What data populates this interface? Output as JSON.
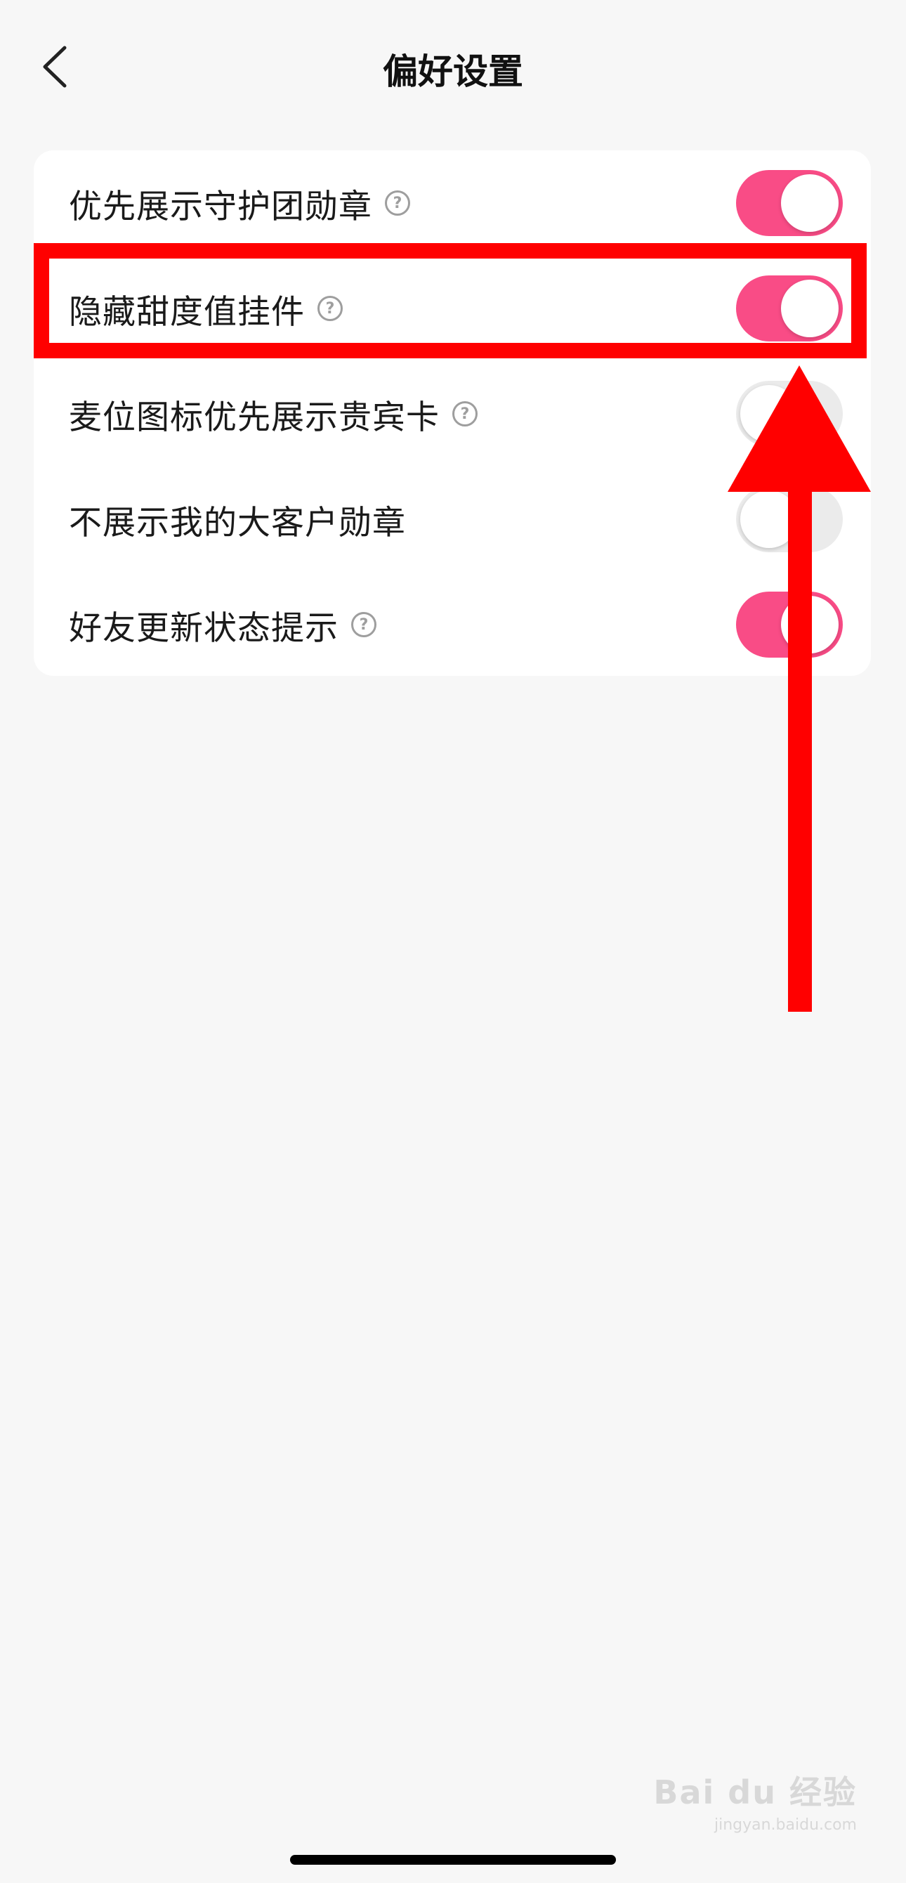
{
  "header": {
    "title": "偏好设置",
    "back_icon": "chevron-left-icon"
  },
  "settings": [
    {
      "label": "优先展示守护团勋章",
      "has_help": true,
      "enabled": true
    },
    {
      "label": "隐藏甜度值挂件",
      "has_help": true,
      "enabled": true
    },
    {
      "label": "麦位图标优先展示贵宾卡",
      "has_help": true,
      "enabled": false
    },
    {
      "label": "不展示我的大客户勋章",
      "has_help": false,
      "enabled": false
    },
    {
      "label": "好友更新状态提示",
      "has_help": true,
      "enabled": true
    }
  ],
  "help_glyph": "?",
  "colors": {
    "background": "#f7f7f7",
    "card": "#ffffff",
    "toggle_on": "#f94c86",
    "toggle_off": "#ebebeb",
    "annotation": "#ff0000"
  },
  "watermark": {
    "main": "Bai du 经验",
    "sub": "jingyan.baidu.com"
  }
}
